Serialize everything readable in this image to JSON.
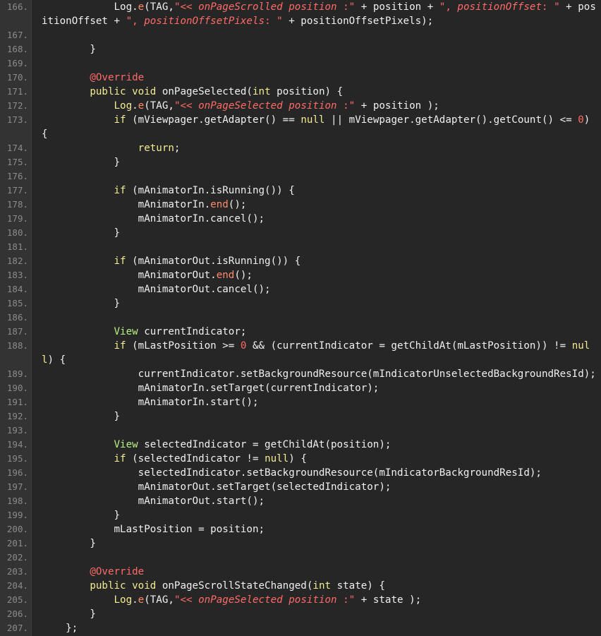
{
  "editor": {
    "theme": {
      "background": "#262626",
      "gutter": "#333333",
      "text": "#f0f0f0",
      "keyword": "#f4ec93",
      "string": "#ff6b68",
      "type": "#b8f088"
    },
    "lines": [
      {
        "n": "166.",
        "tokens": [
          [
            "            ",
            ""
          ],
          [
            "Log",
            ""
          ],
          [
            ".",
            ""
          ],
          [
            "e",
            "fnc"
          ],
          [
            "(TAG,",
            ""
          ],
          [
            "\"<< ",
            "str"
          ],
          [
            "onPageScrolled position",
            "strI"
          ],
          [
            " :\"",
            "str"
          ],
          [
            " + position + ",
            ""
          ],
          [
            "\", ",
            "str"
          ],
          [
            "positionOffset",
            "strI"
          ],
          [
            ": \"",
            "str"
          ],
          [
            " + pos",
            ""
          ]
        ]
      },
      {
        "n": "",
        "tokens": [
          [
            "itionOffset + ",
            ""
          ],
          [
            "\", ",
            "str"
          ],
          [
            "positionOffsetPixels",
            "strI"
          ],
          [
            ": \"",
            "str"
          ],
          [
            " + positionOffsetPixels);",
            ""
          ]
        ]
      },
      {
        "n": "167.",
        "tokens": []
      },
      {
        "n": "168.",
        "tokens": [
          [
            "        }",
            ""
          ]
        ]
      },
      {
        "n": "169.",
        "tokens": []
      },
      {
        "n": "170.",
        "tokens": [
          [
            "        ",
            ""
          ],
          [
            "@Override",
            "ann"
          ]
        ]
      },
      {
        "n": "171.",
        "tokens": [
          [
            "        ",
            ""
          ],
          [
            "public",
            "kw"
          ],
          [
            " ",
            ""
          ],
          [
            "void",
            "kw"
          ],
          [
            " onPageSelected(",
            ""
          ],
          [
            "int",
            "kw"
          ],
          [
            " position) {",
            ""
          ]
        ]
      },
      {
        "n": "172.",
        "tokens": [
          [
            "            ",
            ""
          ],
          [
            "Log",
            "kw"
          ],
          [
            ".",
            ""
          ],
          [
            "e",
            "fnc"
          ],
          [
            "(TAG,",
            ""
          ],
          [
            "\"<< ",
            "str"
          ],
          [
            "onPageSelected position",
            "strI"
          ],
          [
            " :\"",
            "str"
          ],
          [
            " + position );",
            ""
          ]
        ]
      },
      {
        "n": "173.",
        "tokens": [
          [
            "            ",
            ""
          ],
          [
            "if",
            "kw"
          ],
          [
            " (mViewpager.getAdapter() == ",
            ""
          ],
          [
            "null",
            "kw"
          ],
          [
            " || mViewpager.getAdapter().getCount() <= ",
            ""
          ],
          [
            "0",
            "num"
          ],
          [
            ")",
            ""
          ]
        ]
      },
      {
        "n": "",
        "tokens": [
          [
            "{",
            ""
          ]
        ]
      },
      {
        "n": "174.",
        "tokens": [
          [
            "                ",
            ""
          ],
          [
            "return",
            "kw"
          ],
          [
            ";",
            ""
          ]
        ]
      },
      {
        "n": "175.",
        "tokens": [
          [
            "            }",
            ""
          ]
        ]
      },
      {
        "n": "176.",
        "tokens": []
      },
      {
        "n": "177.",
        "tokens": [
          [
            "            ",
            ""
          ],
          [
            "if",
            "kw"
          ],
          [
            " (mAnimatorIn.isRunning()) {",
            ""
          ]
        ]
      },
      {
        "n": "178.",
        "tokens": [
          [
            "                mAnimatorIn.",
            ""
          ],
          [
            "end",
            "fnc"
          ],
          [
            "();",
            ""
          ]
        ]
      },
      {
        "n": "179.",
        "tokens": [
          [
            "                mAnimatorIn.cancel();",
            ""
          ]
        ]
      },
      {
        "n": "180.",
        "tokens": [
          [
            "            }",
            ""
          ]
        ]
      },
      {
        "n": "181.",
        "tokens": []
      },
      {
        "n": "182.",
        "tokens": [
          [
            "            ",
            ""
          ],
          [
            "if",
            "kw"
          ],
          [
            " (mAnimatorOut.isRunning()) {",
            ""
          ]
        ]
      },
      {
        "n": "183.",
        "tokens": [
          [
            "                mAnimatorOut.",
            ""
          ],
          [
            "end",
            "fnc"
          ],
          [
            "();",
            ""
          ]
        ]
      },
      {
        "n": "184.",
        "tokens": [
          [
            "                mAnimatorOut.cancel();",
            ""
          ]
        ]
      },
      {
        "n": "185.",
        "tokens": [
          [
            "            }",
            ""
          ]
        ]
      },
      {
        "n": "186.",
        "tokens": []
      },
      {
        "n": "187.",
        "tokens": [
          [
            "            ",
            ""
          ],
          [
            "View",
            "typ"
          ],
          [
            " currentIndicator;",
            ""
          ]
        ]
      },
      {
        "n": "188.",
        "tokens": [
          [
            "            ",
            ""
          ],
          [
            "if",
            "kw"
          ],
          [
            " (mLastPosition >= ",
            ""
          ],
          [
            "0",
            "num"
          ],
          [
            " && (currentIndicator = getChildAt(mLastPosition)) != ",
            ""
          ],
          [
            "nul",
            "kw"
          ]
        ]
      },
      {
        "n": "",
        "tokens": [
          [
            "l",
            "kw"
          ],
          [
            ") {",
            ""
          ]
        ]
      },
      {
        "n": "189.",
        "tokens": [
          [
            "                currentIndicator.setBackgroundResource(mIndicatorUnselectedBackgroundResId);",
            ""
          ]
        ]
      },
      {
        "n": "190.",
        "tokens": [
          [
            "                mAnimatorIn.setTarget(currentIndicator);",
            ""
          ]
        ]
      },
      {
        "n": "191.",
        "tokens": [
          [
            "                mAnimatorIn.start();",
            ""
          ]
        ]
      },
      {
        "n": "192.",
        "tokens": [
          [
            "            }",
            ""
          ]
        ]
      },
      {
        "n": "193.",
        "tokens": []
      },
      {
        "n": "194.",
        "tokens": [
          [
            "            ",
            ""
          ],
          [
            "View",
            "typ"
          ],
          [
            " selectedIndicator = getChildAt(position);",
            ""
          ]
        ]
      },
      {
        "n": "195.",
        "tokens": [
          [
            "            ",
            ""
          ],
          [
            "if",
            "kw"
          ],
          [
            " (selectedIndicator != ",
            ""
          ],
          [
            "null",
            "kw"
          ],
          [
            ") {",
            ""
          ]
        ]
      },
      {
        "n": "196.",
        "tokens": [
          [
            "                selectedIndicator.setBackgroundResource(mIndicatorBackgroundResId);",
            ""
          ]
        ]
      },
      {
        "n": "197.",
        "tokens": [
          [
            "                mAnimatorOut.setTarget(selectedIndicator);",
            ""
          ]
        ]
      },
      {
        "n": "198.",
        "tokens": [
          [
            "                mAnimatorOut.start();",
            ""
          ]
        ]
      },
      {
        "n": "199.",
        "tokens": [
          [
            "            }",
            ""
          ]
        ]
      },
      {
        "n": "200.",
        "tokens": [
          [
            "            mLastPosition = position;",
            ""
          ]
        ]
      },
      {
        "n": "201.",
        "tokens": [
          [
            "        }",
            ""
          ]
        ]
      },
      {
        "n": "202.",
        "tokens": []
      },
      {
        "n": "203.",
        "tokens": [
          [
            "        ",
            ""
          ],
          [
            "@Override",
            "ann"
          ]
        ]
      },
      {
        "n": "204.",
        "tokens": [
          [
            "        ",
            ""
          ],
          [
            "public",
            "kw"
          ],
          [
            " ",
            ""
          ],
          [
            "void",
            "kw"
          ],
          [
            " onPageScrollStateChanged(",
            ""
          ],
          [
            "int",
            "kw"
          ],
          [
            " state) {",
            ""
          ]
        ]
      },
      {
        "n": "205.",
        "tokens": [
          [
            "            ",
            ""
          ],
          [
            "Log",
            "kw"
          ],
          [
            ".",
            ""
          ],
          [
            "e",
            "fnc"
          ],
          [
            "(TAG,",
            ""
          ],
          [
            "\"<< ",
            "str"
          ],
          [
            "onPageSelected position",
            "strI"
          ],
          [
            " :\"",
            "str"
          ],
          [
            " + state );",
            ""
          ]
        ]
      },
      {
        "n": "206.",
        "tokens": [
          [
            "        }",
            ""
          ]
        ]
      },
      {
        "n": "207.",
        "tokens": [
          [
            "    };",
            ""
          ]
        ]
      }
    ]
  }
}
